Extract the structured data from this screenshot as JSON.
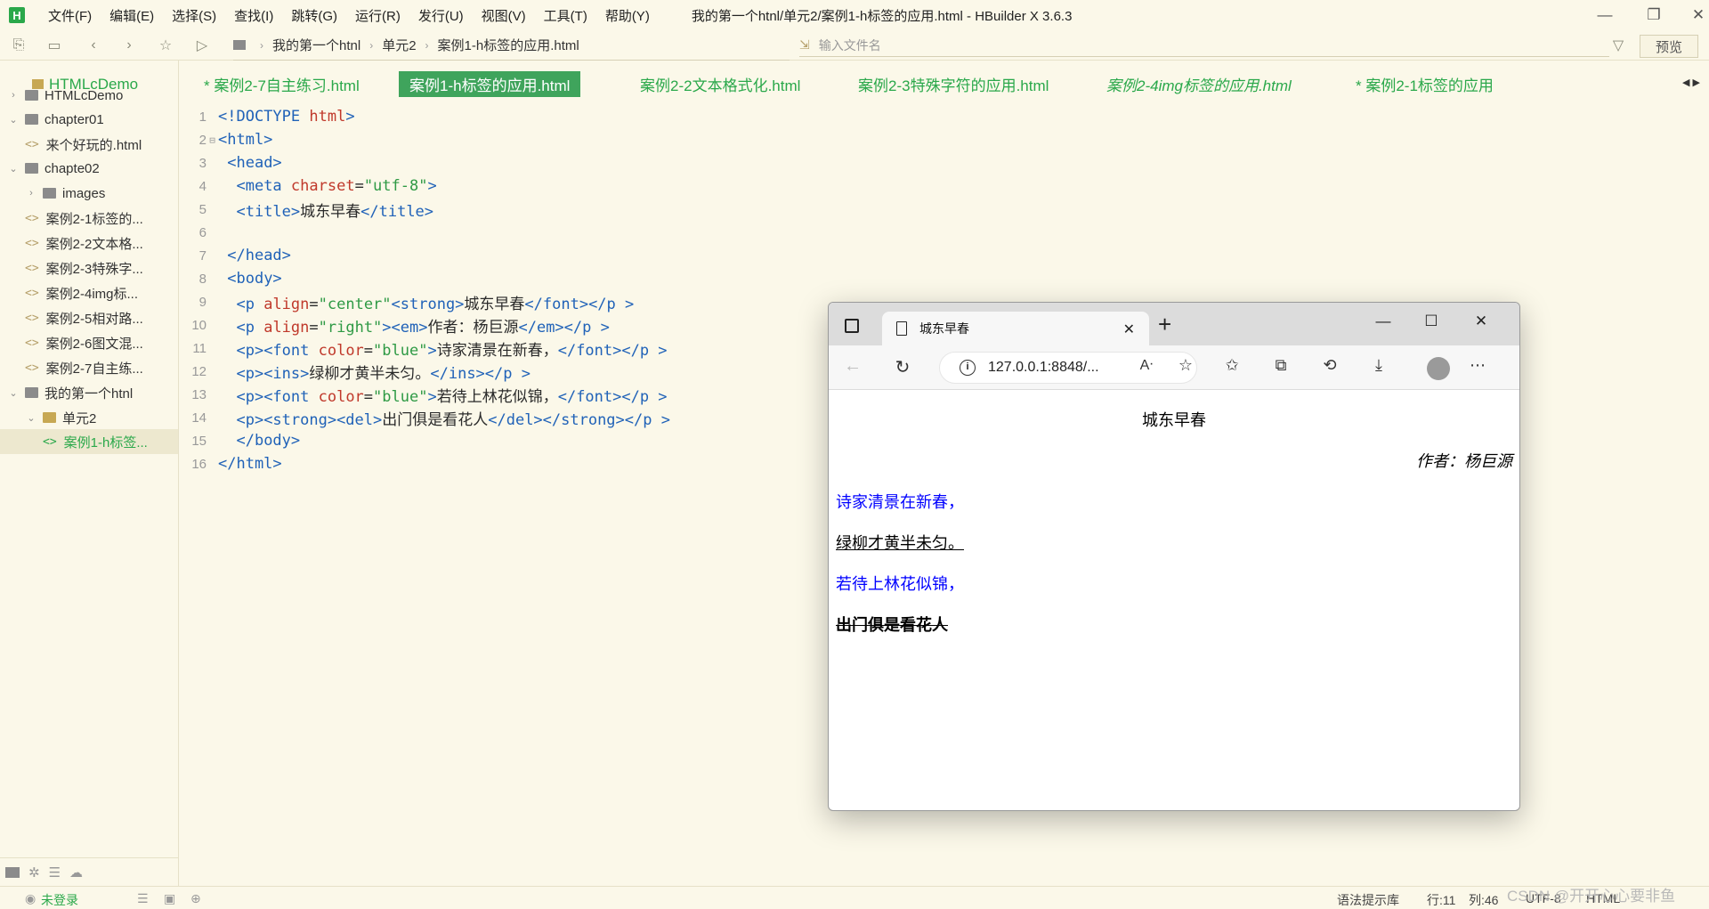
{
  "app": {
    "menu": [
      "文件(F)",
      "编辑(E)",
      "选择(S)",
      "查找(I)",
      "跳转(G)",
      "运行(R)",
      "发行(U)",
      "视图(V)",
      "工具(T)",
      "帮助(Y)"
    ],
    "window_title": "我的第一个htnl/单元2/案例1-h标签的应用.html - HBuilder X 3.6.3",
    "logo_letter": "H"
  },
  "toolbar": {
    "breadcrumb": [
      "我的第一个htnl",
      "单元2",
      "案例1-h标签的应用.html"
    ],
    "file_search_placeholder": "输入文件名",
    "preview_label": "预览"
  },
  "sidebar": {
    "items": [
      {
        "label": "HTMLcDemo",
        "level": 0,
        "type": "folder",
        "expanded": false,
        "selected": false
      },
      {
        "label": "chapter01",
        "level": 0,
        "type": "folder",
        "expanded": true,
        "selected": false
      },
      {
        "label": "来个好玩的.html",
        "level": 1,
        "type": "file",
        "selected": false
      },
      {
        "label": "chapte02",
        "level": 0,
        "type": "folder",
        "expanded": true,
        "selected": false
      },
      {
        "label": "images",
        "level": 1,
        "type": "folder",
        "expanded": false,
        "selected": false
      },
      {
        "label": "案例2-1标签的...",
        "level": 1,
        "type": "file",
        "selected": false
      },
      {
        "label": "案例2-2文本格...",
        "level": 1,
        "type": "file",
        "selected": false
      },
      {
        "label": "案例2-3特殊字...",
        "level": 1,
        "type": "file",
        "selected": false
      },
      {
        "label": "案例2-4img标...",
        "level": 1,
        "type": "file",
        "selected": false
      },
      {
        "label": "案例2-5相对路...",
        "level": 1,
        "type": "file",
        "selected": false
      },
      {
        "label": "案例2-6图文混...",
        "level": 1,
        "type": "file",
        "selected": false
      },
      {
        "label": "案例2-7自主练...",
        "level": 1,
        "type": "file",
        "selected": false
      },
      {
        "label": "我的第一个htnl",
        "level": 0,
        "type": "folder",
        "expanded": true,
        "selected": false
      },
      {
        "label": "单元2",
        "level": 1,
        "type": "folder-open",
        "expanded": true,
        "selected": false
      },
      {
        "label": "案例1-h标签...",
        "level": 2,
        "type": "file",
        "selected": true
      }
    ]
  },
  "tabs": [
    {
      "label": "HTMLcDemo",
      "active": false,
      "italic": false,
      "folder": true
    },
    {
      "label": "* 案例2-7自主练习.html",
      "active": false,
      "italic": false
    },
    {
      "label": "案例1-h标签的应用.html",
      "active": true,
      "italic": false
    },
    {
      "label": "案例2-2文本格式化.html",
      "active": false,
      "italic": false
    },
    {
      "label": "案例2-3特殊字符的应用.html",
      "active": false,
      "italic": false
    },
    {
      "label": "案例2-4img标签的应用.html",
      "active": false,
      "italic": true
    },
    {
      "label": "* 案例2-1标签的应用",
      "active": false,
      "italic": false
    }
  ],
  "editor": {
    "line_numbers": [
      "1",
      "2",
      "3",
      "4",
      "5",
      "6",
      "7",
      "8",
      "9",
      "10",
      "11",
      "12",
      "13",
      "14",
      "15",
      "16"
    ],
    "lines": [
      [
        [
          "doc",
          "<!DOCTYPE "
        ],
        [
          "attr",
          "html"
        ],
        [
          "doc",
          ">"
        ]
      ],
      [
        [
          "tag",
          "<html>"
        ]
      ],
      [
        [
          "txt",
          " "
        ],
        [
          "tag",
          "<head>"
        ]
      ],
      [
        [
          "txt",
          "  "
        ],
        [
          "tag",
          "<meta "
        ],
        [
          "attr",
          "charset"
        ],
        [
          "txt",
          "="
        ],
        [
          "str",
          "\"utf-8\""
        ],
        [
          "tag",
          ">"
        ]
      ],
      [
        [
          "txt",
          "  "
        ],
        [
          "tag",
          "<title>"
        ],
        [
          "txt",
          "城东早春"
        ],
        [
          "tag",
          "</title>"
        ]
      ],
      [],
      [
        [
          "txt",
          " "
        ],
        [
          "tag",
          "</head>"
        ]
      ],
      [
        [
          "txt",
          " "
        ],
        [
          "tag",
          "<body>"
        ]
      ],
      [
        [
          "txt",
          "  "
        ],
        [
          "tag",
          "<p "
        ],
        [
          "attr",
          "align"
        ],
        [
          "txt",
          "="
        ],
        [
          "str",
          "\"center\""
        ],
        [
          "tag",
          "<strong>"
        ],
        [
          "txt",
          "城东早春"
        ],
        [
          "tag",
          "</font></p >"
        ]
      ],
      [
        [
          "txt",
          "  "
        ],
        [
          "tag",
          "<p "
        ],
        [
          "attr",
          "align"
        ],
        [
          "txt",
          "="
        ],
        [
          "str",
          "\"right\""
        ],
        [
          "tag",
          "><em>"
        ],
        [
          "txt",
          "作者：杨巨源"
        ],
        [
          "tag",
          "</em></p >"
        ]
      ],
      [
        [
          "txt",
          "  "
        ],
        [
          "tag",
          "<p><font "
        ],
        [
          "attr",
          "color"
        ],
        [
          "txt",
          "="
        ],
        [
          "str",
          "\"blue\""
        ],
        [
          "tag",
          ">"
        ],
        [
          "txt",
          "诗家清景在新春，"
        ],
        [
          "tag",
          "</font></p >"
        ]
      ],
      [
        [
          "txt",
          "  "
        ],
        [
          "tag",
          "<p><ins>"
        ],
        [
          "txt",
          "绿柳才黄半未匀。"
        ],
        [
          "tag",
          "</ins></p >"
        ]
      ],
      [
        [
          "txt",
          "  "
        ],
        [
          "tag",
          "<p><font "
        ],
        [
          "attr",
          "color"
        ],
        [
          "txt",
          "="
        ],
        [
          "str",
          "\"blue\""
        ],
        [
          "tag",
          ">"
        ],
        [
          "txt",
          "若待上林花似锦，"
        ],
        [
          "tag",
          "</font></p >"
        ]
      ],
      [
        [
          "txt",
          "  "
        ],
        [
          "tag",
          "<p><strong><del>"
        ],
        [
          "txt",
          "出门俱是看花人"
        ],
        [
          "tag",
          "</del></strong></p >"
        ]
      ],
      [
        [
          "txt",
          "  "
        ],
        [
          "tag",
          "</body>"
        ]
      ],
      [
        [
          "tag",
          "</html>"
        ]
      ]
    ]
  },
  "browser": {
    "tab_title": "城东早春",
    "address": "127.0.0.1:8848/...",
    "content": {
      "title": "城东早春",
      "author": "作者：杨巨源",
      "line1": "诗家清景在新春，",
      "line2": "绿柳才黄半未匀。",
      "line3": "若待上林花似锦，",
      "line4": "出门俱是看花人"
    }
  },
  "statusbar": {
    "login": "未登录",
    "grammar": "语法提示库",
    "row": "行:11",
    "col": "列:46",
    "encoding": "UTF-8",
    "language": "HTML"
  },
  "watermark": "CSDN @开开心心要非鱼",
  "colors": {
    "accent_green": "#2aa84a",
    "background": "#fbf8e9",
    "tag_blue": "#2062b8",
    "attr_red": "#c0392b",
    "string_green": "#2f9a45",
    "font_blue": "#0000ff"
  }
}
